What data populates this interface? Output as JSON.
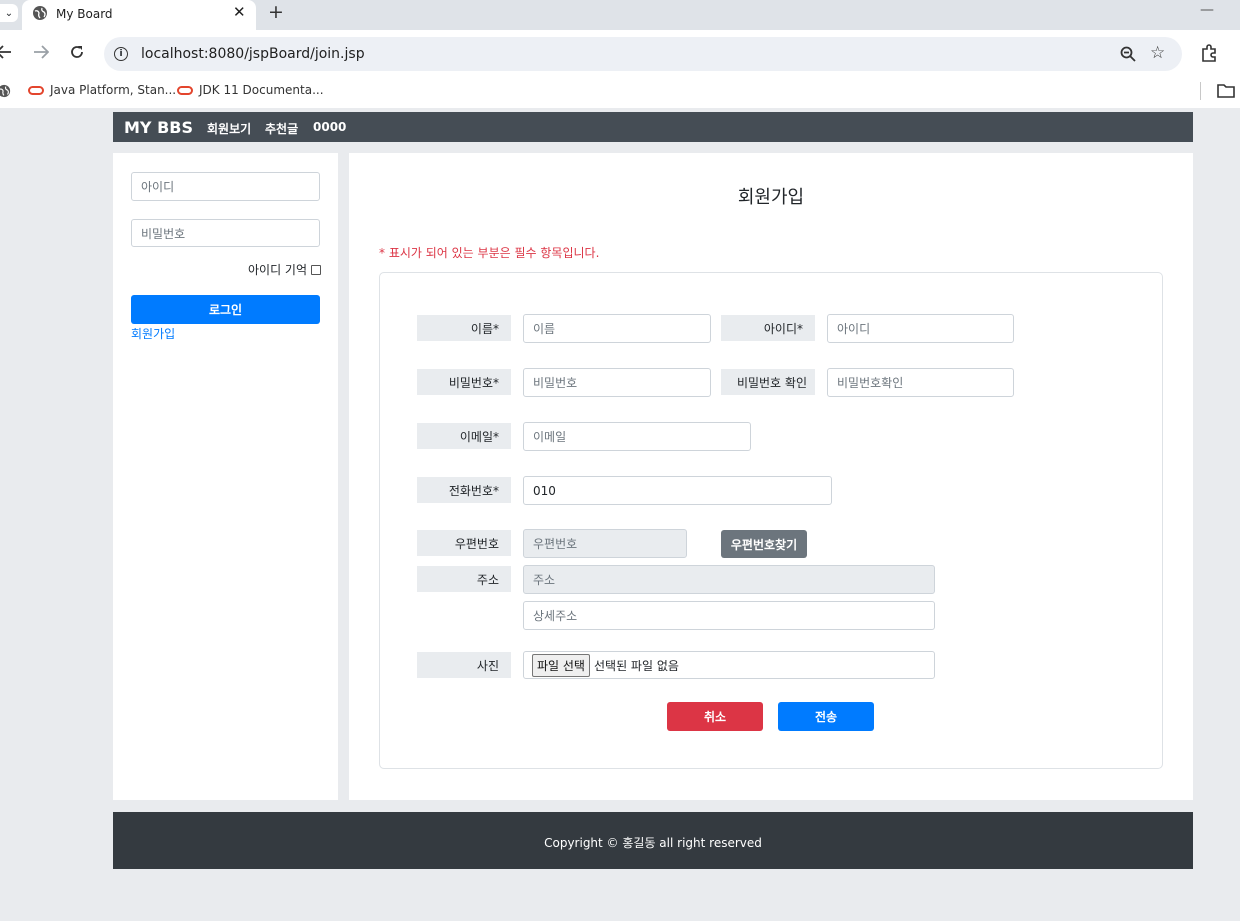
{
  "browser": {
    "tab_title": "My Board",
    "tab_close": "✕",
    "new_tab": "+",
    "minimize": "—",
    "url": "localhost:8080/jspBoard/join.jsp",
    "bookmarks": [
      "Java Platform, Stan...",
      "JDK 11 Documenta..."
    ]
  },
  "navbar": {
    "brand": "MY BBS",
    "links": [
      "회원보기",
      "추천글",
      "0000"
    ]
  },
  "sidebar": {
    "id_placeholder": "아이디",
    "pw_placeholder": "비밀번호",
    "remember_label": "아이디 기억",
    "login_button": "로그인",
    "join_link": "회원가입"
  },
  "form": {
    "title": "회원가입",
    "notice": "* 표시가 되어 있는 부분은 필수 항목입니다.",
    "fields": {
      "name_label": "이름*",
      "name_placeholder": "이름",
      "userid_label": "아이디*",
      "userid_placeholder": "아이디",
      "password_label": "비밀번호*",
      "password_placeholder": "비밀번호",
      "password_confirm_label": "비밀번호 확인",
      "password_confirm_placeholder": "비밀번호확인",
      "email_label": "이메일*",
      "email_placeholder": "이메일",
      "phone_label": "전화번호*",
      "phone_value": "010",
      "zip_label": "우편번호",
      "zip_placeholder": "우편번호",
      "zip_button": "우편번호찾기",
      "address_label": "주소",
      "address_placeholder": "주소",
      "address_detail_placeholder": "상세주소",
      "photo_label": "사진",
      "file_button": "파일 선택",
      "file_status": "선택된 파일 없음"
    },
    "cancel_button": "취소",
    "submit_button": "전송"
  },
  "footer": {
    "copyright": "Copyright © 홍길동 all right reserved"
  },
  "colors": {
    "navbar": "#454d55",
    "primary": "#007bff",
    "danger": "#dc3545",
    "secondary": "#6c757d",
    "footer": "#343a40"
  }
}
